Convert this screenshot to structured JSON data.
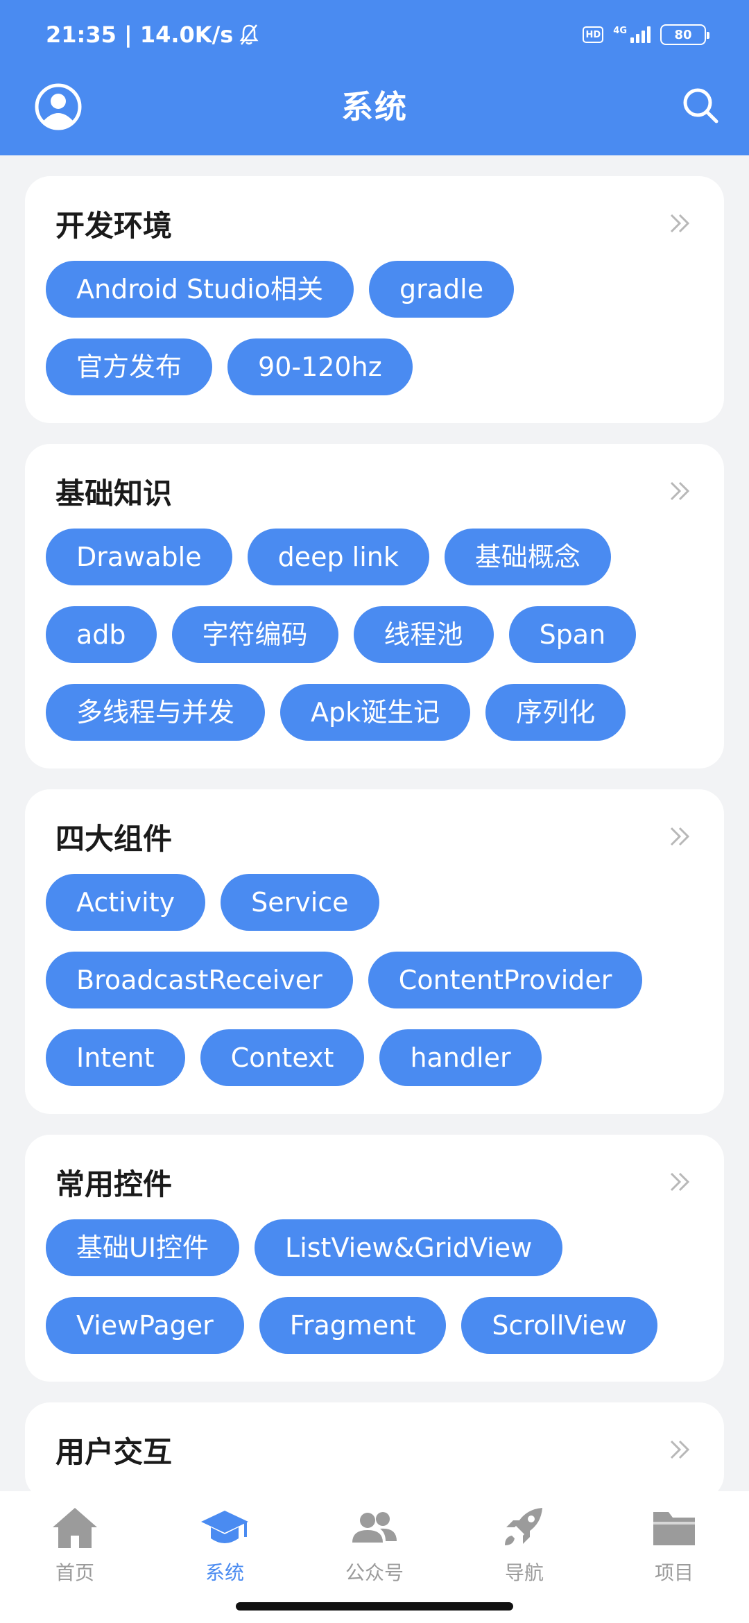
{
  "status": {
    "time": "21:35 | 14.0K/s",
    "hd": "HD",
    "network": "4G",
    "battery": "80"
  },
  "header": {
    "title": "系统"
  },
  "cards": [
    {
      "title": "开发环境",
      "tags": [
        "Android Studio相关",
        "gradle",
        "官方发布",
        "90-120hz"
      ]
    },
    {
      "title": "基础知识",
      "tags": [
        "Drawable",
        "deep link",
        "基础概念",
        "adb",
        "字符编码",
        "线程池",
        "Span",
        "多线程与并发",
        "Apk诞生记",
        "序列化"
      ]
    },
    {
      "title": "四大组件",
      "tags": [
        "Activity",
        "Service",
        "BroadcastReceiver",
        "ContentProvider",
        "Intent",
        "Context",
        "handler"
      ]
    },
    {
      "title": "常用控件",
      "tags": [
        "基础UI控件",
        "ListView&GridView",
        "ViewPager",
        "Fragment",
        "ScrollView"
      ]
    },
    {
      "title": "用户交互",
      "tags": []
    }
  ],
  "bottom_nav": [
    {
      "label": "首页",
      "icon": "home-icon",
      "active": false
    },
    {
      "label": "系统",
      "icon": "graduation-cap-icon",
      "active": true
    },
    {
      "label": "公众号",
      "icon": "people-icon",
      "active": false
    },
    {
      "label": "导航",
      "icon": "rocket-icon",
      "active": false
    },
    {
      "label": "项目",
      "icon": "folder-icon",
      "active": false
    }
  ],
  "colors": {
    "primary": "#4A8BF1",
    "background": "#F2F3F5",
    "inactive": "#9B9B9B"
  }
}
